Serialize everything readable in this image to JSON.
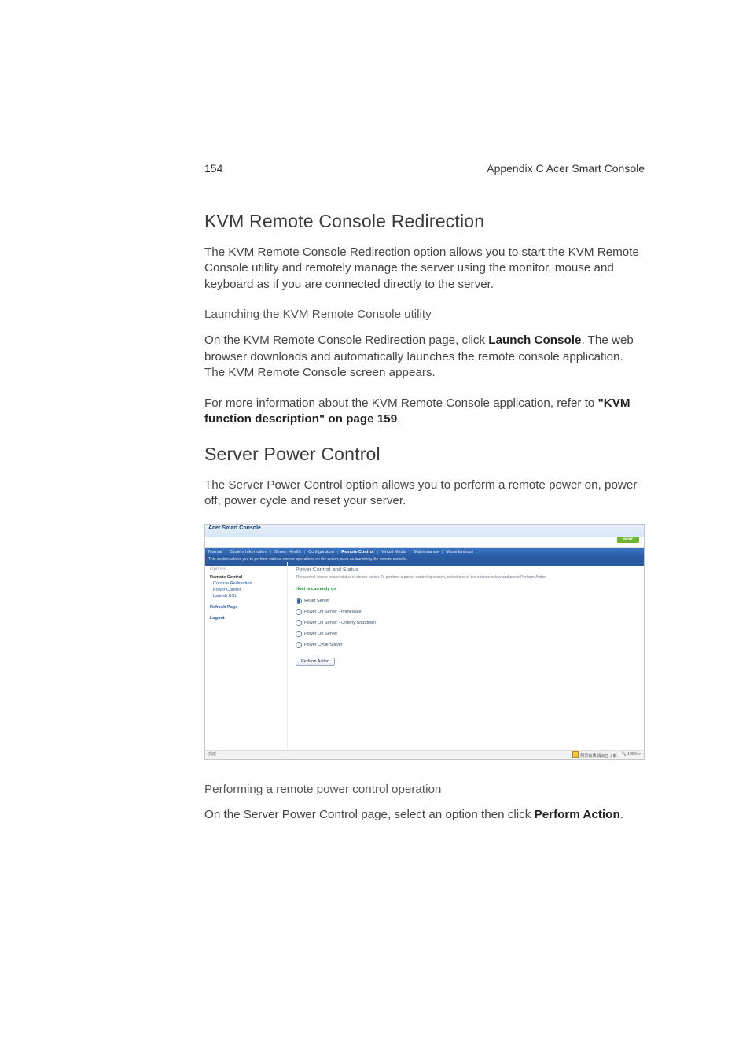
{
  "running_head": {
    "page_number": "154",
    "title": "Appendix C Acer Smart Console"
  },
  "sec1": {
    "heading": "KVM Remote Console Redirection",
    "para1": "The KVM Remote Console Redirection option allows you to start the KVM Remote Console utility and remotely manage the server using the monitor, mouse and keyboard as if you are connected directly to the server.",
    "subhead": "Launching the KVM Remote Console utility",
    "para2a": "On the KVM Remote Console Redirection page, click ",
    "para2b": "Launch Console",
    "para2c": ". The web browser downloads and automatically launches the remote console application. The KVM Remote Console screen appears.",
    "para3a": "For more information about the KVM Remote Console application, refer to ",
    "para3b": "\"KVM function description\" on page 159",
    "para3c": "."
  },
  "sec2": {
    "heading": "Server Power Control",
    "para1": "The Server Power Control option allows you to perform a remote power on, power off, power cycle and reset your server.",
    "subhead": "Performing a remote power control operation",
    "para2a": "On the Server Power Control page, select an option then click ",
    "para2b": "Perform Action",
    "para2c": "."
  },
  "screenshot": {
    "window_title": "Acer Smart Console",
    "brand": "acer",
    "tabs": [
      "Normal",
      "System Information",
      "Server Health",
      "Configuration",
      "Remote Control",
      "Virtual Media",
      "Maintenance",
      "Miscellaneous"
    ],
    "active_tab_index": 4,
    "subbar": "This section allows you to perform various remote operations on the server, such as launching the remote console.",
    "sidebar": {
      "header": "Options",
      "group": "Remote Control",
      "items": [
        "Console Redirection",
        "Power Control",
        "Launch SOL"
      ],
      "links": [
        "Refresh Page",
        "Logout"
      ]
    },
    "main": {
      "heading": "Power Control and Status",
      "desc": "The current server power status is shown below. To perform a power control operation, select one of the options below and press Perform Action.",
      "status": "Host is currently on",
      "options": [
        {
          "label": "Reset Server",
          "checked": true
        },
        {
          "label": "Power Off Server - Immediate",
          "checked": false
        },
        {
          "label": "Power Off Server - Orderly Shutdown",
          "checked": false
        },
        {
          "label": "Power On Server",
          "checked": false
        },
        {
          "label": "Power Cycle Server",
          "checked": false
        }
      ],
      "button": "Perform Action"
    },
    "statusbar": {
      "left": "完成",
      "security_msg": "网页错误,请双击了解",
      "zoom": "100%"
    }
  }
}
